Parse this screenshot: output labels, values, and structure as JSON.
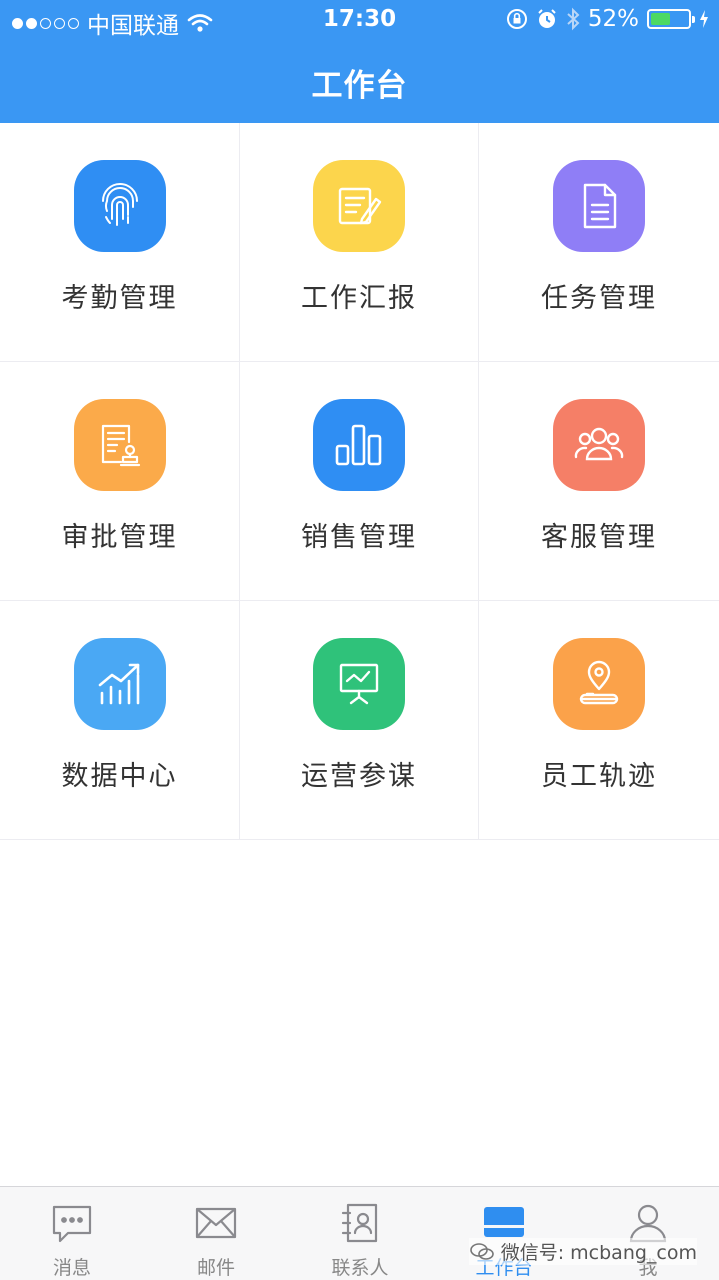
{
  "status_bar": {
    "carrier": "中国联通",
    "time": "17:30",
    "battery_text": "52%",
    "battery_level": 0.52
  },
  "header": {
    "title": "工作台"
  },
  "modules": [
    {
      "label": "考勤管理",
      "icon": "fingerprint-icon",
      "color": "#2f8ef3"
    },
    {
      "label": "工作汇报",
      "icon": "report-edit-icon",
      "color": "#fcd54c"
    },
    {
      "label": "任务管理",
      "icon": "document-icon",
      "color": "#8f7ef6"
    },
    {
      "label": "审批管理",
      "icon": "approval-stamp-icon",
      "color": "#fbaa4a"
    },
    {
      "label": "销售管理",
      "icon": "bar-chart-icon",
      "color": "#2f8ef3"
    },
    {
      "label": "客服管理",
      "icon": "customers-icon",
      "color": "#f57f67"
    },
    {
      "label": "数据中心",
      "icon": "trend-chart-icon",
      "color": "#4aa8f4"
    },
    {
      "label": "运营参谋",
      "icon": "presentation-icon",
      "color": "#2fc27a"
    },
    {
      "label": "员工轨迹",
      "icon": "location-pin-icon",
      "color": "#fba24a"
    }
  ],
  "tabbar": {
    "items": [
      {
        "label": "消息",
        "icon": "message-icon"
      },
      {
        "label": "邮件",
        "icon": "mail-icon"
      },
      {
        "label": "联系人",
        "icon": "contacts-icon"
      },
      {
        "label": "工作台",
        "icon": "workbench-icon",
        "active": true
      },
      {
        "label": "我",
        "icon": "profile-icon"
      }
    ],
    "active_color": "#2f8ef0"
  },
  "watermark": {
    "text": "微信号: mcbang_com"
  }
}
